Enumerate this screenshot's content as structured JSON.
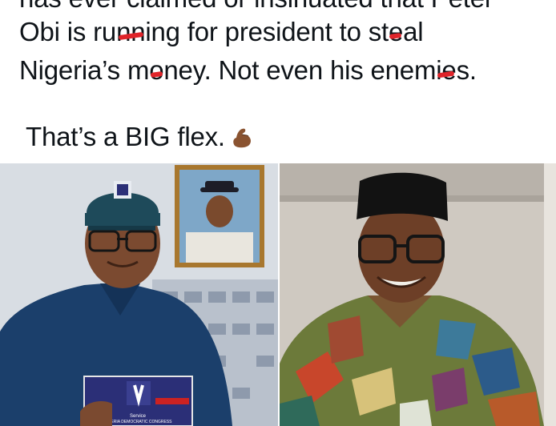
{
  "post": {
    "line0": "has ever claimed or insinuated that Peter",
    "line1a": "Obi is ru",
    "line1b": "nn",
    "line1c": "ing for president to st",
    "line1d": "e",
    "line1e": "al",
    "line2a": "Nigeria’s m",
    "line2b": "o",
    "line2c": "ney. Not even his enem",
    "line2d": "ie",
    "line2e": "s.",
    "line3": "That’s a BIG flex."
  },
  "images": {
    "left": {
      "badge_title": "Service",
      "badge_subtitle": "NIGERIA DEMOCRATIC CONGRESS"
    },
    "right": {}
  },
  "colors": {
    "strike": "#e0242a",
    "cap": "#1e4a5a",
    "shirt": "#1b3f6b",
    "flag_badge": "#2b2f77"
  },
  "icons": [
    "flexed-biceps-emoji"
  ]
}
